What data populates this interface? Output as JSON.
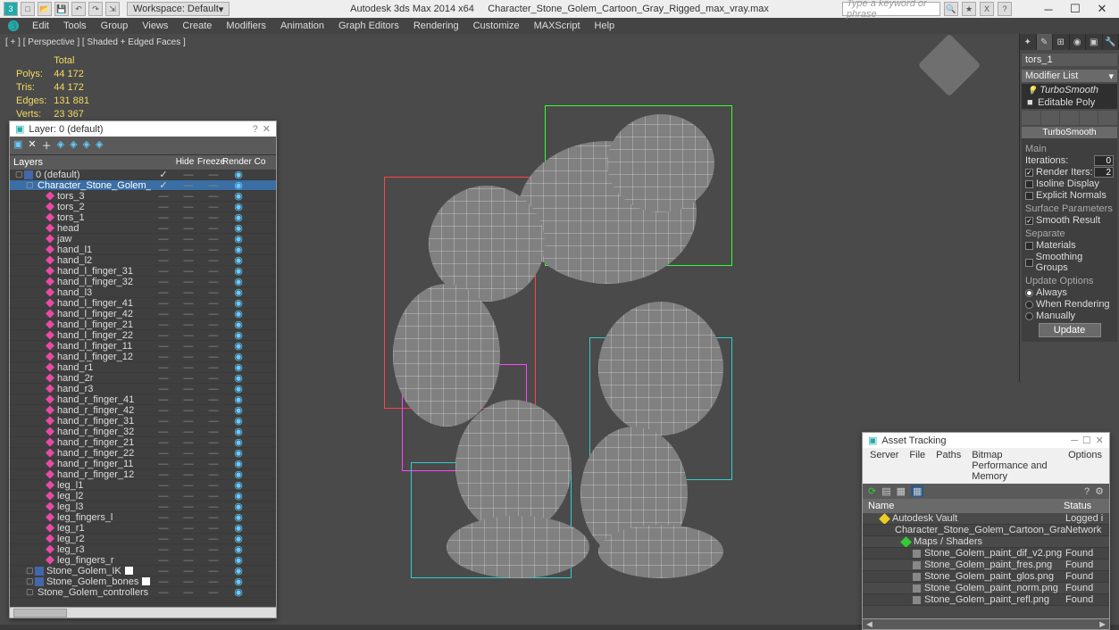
{
  "title": {
    "app": "Autodesk 3ds Max  2014 x64",
    "file": "Character_Stone_Golem_Cartoon_Gray_Rigged_max_vray.max",
    "workspace_label": "Workspace: Default",
    "search_placeholder": "Type a keyword or phrase"
  },
  "menus": [
    "Edit",
    "Tools",
    "Group",
    "Views",
    "Create",
    "Modifiers",
    "Animation",
    "Graph Editors",
    "Rendering",
    "Customize",
    "MAXScript",
    "Help"
  ],
  "viewport": {
    "label": "[ + ] [ Perspective ] [ Shaded + Edged Faces  ]"
  },
  "stats": {
    "header": "Total",
    "polys_l": "Polys:",
    "polys_v": "44 172",
    "tris_l": "Tris:",
    "tris_v": "44 172",
    "edges_l": "Edges:",
    "edges_v": "131 881",
    "verts_l": "Verts:",
    "verts_v": "23 367"
  },
  "cmd": {
    "selname": "tors_1",
    "modlist": "Modifier List",
    "stack": [
      "TurboSmooth",
      "Editable Poly"
    ],
    "rollup": "TurboSmooth",
    "main": "Main",
    "iter_l": "Iterations:",
    "iter_v": "0",
    "rend_iter_l": "Render Iters:",
    "rend_iter_v": "2",
    "isoline": "Isoline Display",
    "explicit": "Explicit Normals",
    "surf": "Surface Parameters",
    "smooth": "Smooth Result",
    "separate": "Separate",
    "materials": "Materials",
    "sgroups": "Smoothing Groups",
    "update": "Update Options",
    "always": "Always",
    "when": "When Rendering",
    "manual": "Manually",
    "update_btn": "Update"
  },
  "layers": {
    "title": "Layer: 0 (default)",
    "cols": [
      "Layers",
      "Hide",
      "Freeze",
      "Render",
      "Co"
    ],
    "items": [
      {
        "t": "layer",
        "d": 0,
        "n": "0 (default)",
        "tick": true
      },
      {
        "t": "layer",
        "d": 1,
        "n": "Character_Stone_Golem_Cartoon_Gray_Rigged",
        "sel": true,
        "chk": true,
        "tick": true
      },
      {
        "t": "obj",
        "d": 2,
        "n": "tors_3"
      },
      {
        "t": "obj",
        "d": 2,
        "n": "tors_2"
      },
      {
        "t": "obj",
        "d": 2,
        "n": "tors_1"
      },
      {
        "t": "obj",
        "d": 2,
        "n": "head"
      },
      {
        "t": "obj",
        "d": 2,
        "n": "jaw"
      },
      {
        "t": "obj",
        "d": 2,
        "n": "hand_l1"
      },
      {
        "t": "obj",
        "d": 2,
        "n": "hand_l2"
      },
      {
        "t": "obj",
        "d": 2,
        "n": "hand_l_finger_31"
      },
      {
        "t": "obj",
        "d": 2,
        "n": "hand_l_finger_32"
      },
      {
        "t": "obj",
        "d": 2,
        "n": "hand_l3"
      },
      {
        "t": "obj",
        "d": 2,
        "n": "hand_l_finger_41"
      },
      {
        "t": "obj",
        "d": 2,
        "n": "hand_l_finger_42"
      },
      {
        "t": "obj",
        "d": 2,
        "n": "hand_l_finger_21"
      },
      {
        "t": "obj",
        "d": 2,
        "n": "hand_l_finger_22"
      },
      {
        "t": "obj",
        "d": 2,
        "n": "hand_l_finger_11"
      },
      {
        "t": "obj",
        "d": 2,
        "n": "hand_l_finger_12"
      },
      {
        "t": "obj",
        "d": 2,
        "n": "hand_r1"
      },
      {
        "t": "obj",
        "d": 2,
        "n": "hand_2r"
      },
      {
        "t": "obj",
        "d": 2,
        "n": "hand_r3"
      },
      {
        "t": "obj",
        "d": 2,
        "n": "hand_r_finger_41"
      },
      {
        "t": "obj",
        "d": 2,
        "n": "hand_r_finger_42"
      },
      {
        "t": "obj",
        "d": 2,
        "n": "hand_r_finger_31"
      },
      {
        "t": "obj",
        "d": 2,
        "n": "hand_r_finger_32"
      },
      {
        "t": "obj",
        "d": 2,
        "n": "hand_r_finger_21"
      },
      {
        "t": "obj",
        "d": 2,
        "n": "hand_r_finger_22"
      },
      {
        "t": "obj",
        "d": 2,
        "n": "hand_r_finger_11"
      },
      {
        "t": "obj",
        "d": 2,
        "n": "hand_r_finger_12"
      },
      {
        "t": "obj",
        "d": 2,
        "n": "leg_l1"
      },
      {
        "t": "obj",
        "d": 2,
        "n": "leg_l2"
      },
      {
        "t": "obj",
        "d": 2,
        "n": "leg_l3"
      },
      {
        "t": "obj",
        "d": 2,
        "n": "leg_fingers_l"
      },
      {
        "t": "obj",
        "d": 2,
        "n": "leg_r1"
      },
      {
        "t": "obj",
        "d": 2,
        "n": "leg_r2"
      },
      {
        "t": "obj",
        "d": 2,
        "n": "leg_r3"
      },
      {
        "t": "obj",
        "d": 2,
        "n": "leg_fingers_r"
      },
      {
        "t": "layer",
        "d": 1,
        "n": "Stone_Golem_IK",
        "chk": true
      },
      {
        "t": "layer",
        "d": 1,
        "n": "Stone_Golem_bones",
        "chk": true
      },
      {
        "t": "layer",
        "d": 1,
        "n": "Stone_Golem_controllers",
        "chk": true
      }
    ]
  },
  "asset": {
    "title": "Asset Tracking",
    "menus": [
      "Server",
      "File",
      "Paths",
      "Bitmap Performance and Memory",
      "Options"
    ],
    "head": {
      "name": "Name",
      "status": "Status"
    },
    "rows": [
      {
        "ind": 1,
        "ico": "yellow",
        "name": "Autodesk Vault",
        "status": "Logged i"
      },
      {
        "ind": 2,
        "ico": "blue",
        "name": "Character_Stone_Golem_Cartoon_Gray_Rigged_max_vray....",
        "status": "Network"
      },
      {
        "ind": 3,
        "ico": "green",
        "name": "Maps / Shaders",
        "status": ""
      },
      {
        "ind": 4,
        "ico": "sq",
        "name": "Stone_Golem_paint_dif_v2.png",
        "status": "Found"
      },
      {
        "ind": 4,
        "ico": "sq",
        "name": "Stone_Golem_paint_fres.png",
        "status": "Found"
      },
      {
        "ind": 4,
        "ico": "sq",
        "name": "Stone_Golem_paint_glos.png",
        "status": "Found"
      },
      {
        "ind": 4,
        "ico": "sq",
        "name": "Stone_Golem_paint_norm.png",
        "status": "Found"
      },
      {
        "ind": 4,
        "ico": "sq",
        "name": "Stone_Golem_paint_refl.png",
        "status": "Found"
      }
    ]
  }
}
